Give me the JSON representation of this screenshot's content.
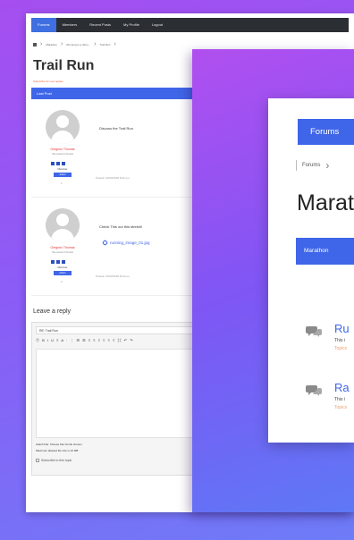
{
  "back": {
    "nav": [
      "Forums",
      "Members",
      "Recent Posts",
      "My Profile",
      "Logout"
    ],
    "breadcrumb": [
      "Marathon",
      "Running is a often...",
      "Trail Run"
    ],
    "title": "Trail Run",
    "subscribe": "Subscribe for new replies",
    "header": "Last Post",
    "posts": [
      {
        "author": "Gregorio Thomas",
        "meta": "Has posted 2 threads",
        "role": "Member",
        "badge": "Admin",
        "num": "1",
        "content": "Discuss the Trail Run",
        "posted": "Posted: 10/03/2018 8:41 pm",
        "attachment": ""
      },
      {
        "author": "Gregorio Thomas",
        "meta": "Has posted 2 threads",
        "role": "Member",
        "badge": "Admin",
        "num": "2",
        "content": "Check This out this stretch!",
        "posted": "Posted: 10/03/2018 8:44 pm",
        "attachment": "running_image_01.jpg"
      }
    ],
    "reply": {
      "title": "Leave a reply",
      "subject_value": "RE: Trail Run",
      "toolbar": "Ⓣ  B  I  U  ≡  A  ·  ⋮  ☰  ☰  ≡  ≡  ≡  ≡  ≡  ≡  ⌘  ↶  ↷",
      "attach_file": "Attach File:   Choose File   No file chosen",
      "max_size": "Maximum allowed file size is 10 MB",
      "subscribe_label": "Subscribe to this topic"
    }
  },
  "front": {
    "tab": "Forums",
    "crumb": "Forums",
    "title": "Marathon",
    "header": "Marathon",
    "topics": [
      {
        "title": "Ru",
        "desc": "This i",
        "meta": "Topics"
      },
      {
        "title": "Ra",
        "desc": "This i",
        "meta": "Topics"
      }
    ]
  },
  "colors": {
    "accent": "#3f66e8",
    "author": "#dd3333",
    "subscribe": "#e35d3c"
  }
}
